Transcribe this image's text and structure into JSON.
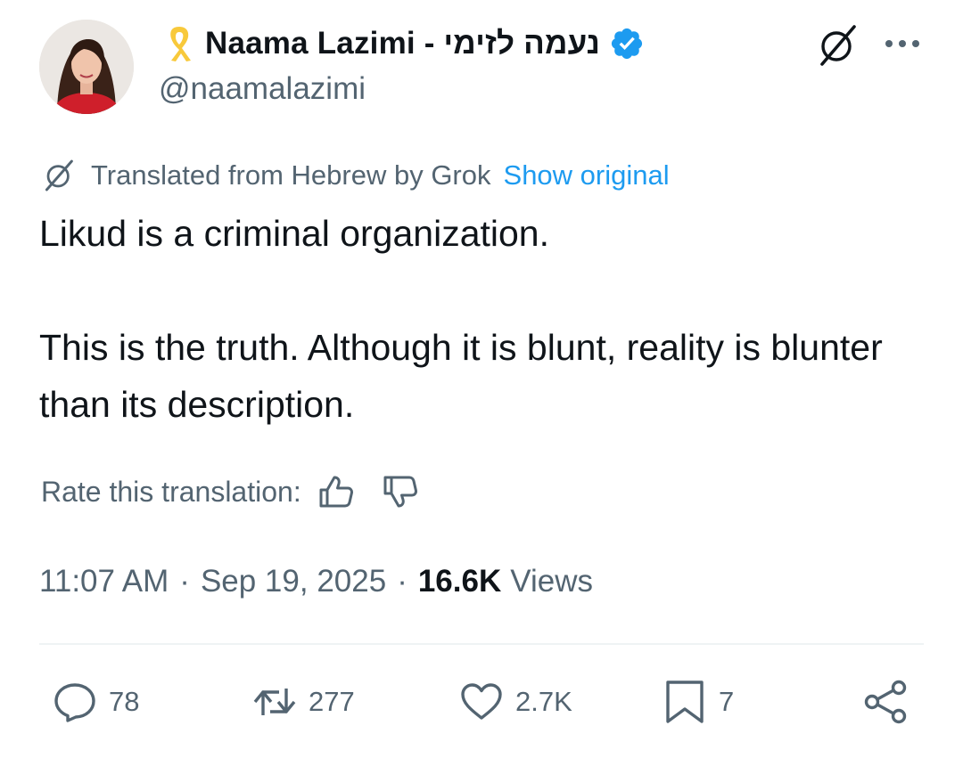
{
  "author": {
    "display_name": "Naama Lazimi - נעמה לזימי",
    "handle": "@naamalazimi",
    "verified": true
  },
  "translation": {
    "notice": "Translated from Hebrew by Grok",
    "show_original": "Show original"
  },
  "tweet": {
    "paragraphs": [
      "Likud is a criminal organization.",
      "This is the truth. Although it is blunt, reality is blunter than its description."
    ]
  },
  "rating": {
    "label": "Rate this translation:"
  },
  "meta": {
    "time": "11:07 AM",
    "separator": "·",
    "date": "Sep 19, 2025",
    "views_count": "16.6K",
    "views_label": "Views"
  },
  "actions": {
    "replies": "78",
    "reposts": "277",
    "likes": "2.7K",
    "bookmarks": "7"
  },
  "icons": {
    "ribbon": "yellow-ribbon-icon",
    "verified": "verified-badge-icon",
    "grok": "grok-icon",
    "more": "more-icon",
    "thumbs_up": "thumbs-up-icon",
    "thumbs_down": "thumbs-down-icon",
    "reply": "reply-icon",
    "repost": "repost-icon",
    "like": "heart-icon",
    "bookmark": "bookmark-icon",
    "share": "share-icon"
  },
  "colors": {
    "text": "#0f1419",
    "secondary": "#536471",
    "link": "#1d9bf0",
    "verified": "#1d9bf0",
    "ribbon": "#f8c93b",
    "divider": "#eff3f4"
  }
}
